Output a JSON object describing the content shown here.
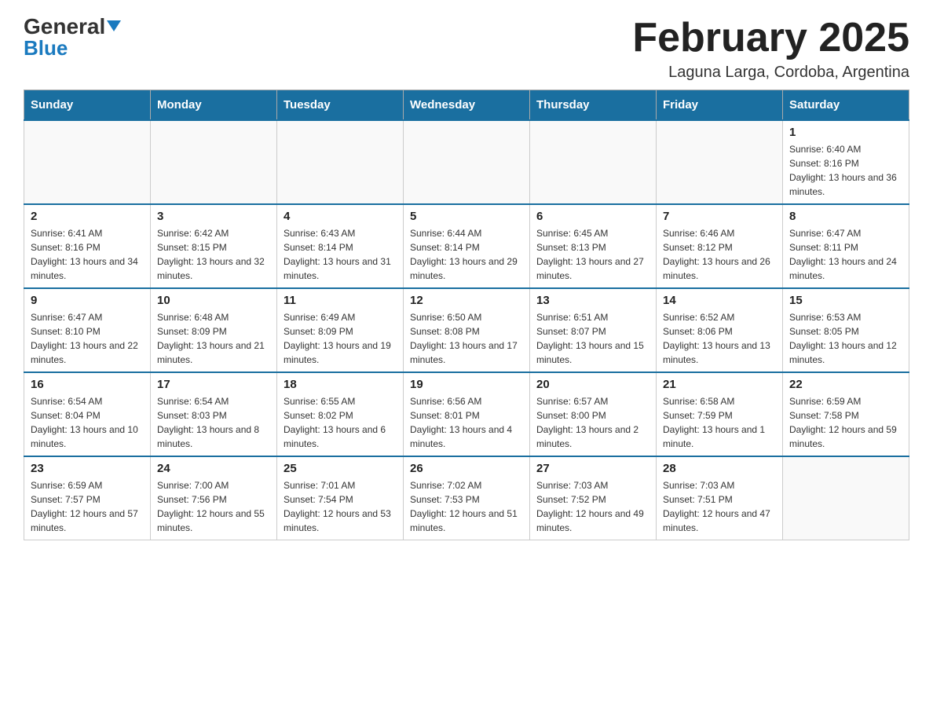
{
  "header": {
    "logo_general": "General",
    "logo_blue": "Blue",
    "title": "February 2025",
    "subtitle": "Laguna Larga, Cordoba, Argentina"
  },
  "days_of_week": [
    "Sunday",
    "Monday",
    "Tuesday",
    "Wednesday",
    "Thursday",
    "Friday",
    "Saturday"
  ],
  "weeks": [
    [
      {
        "day": "",
        "info": ""
      },
      {
        "day": "",
        "info": ""
      },
      {
        "day": "",
        "info": ""
      },
      {
        "day": "",
        "info": ""
      },
      {
        "day": "",
        "info": ""
      },
      {
        "day": "",
        "info": ""
      },
      {
        "day": "1",
        "info": "Sunrise: 6:40 AM\nSunset: 8:16 PM\nDaylight: 13 hours and 36 minutes."
      }
    ],
    [
      {
        "day": "2",
        "info": "Sunrise: 6:41 AM\nSunset: 8:16 PM\nDaylight: 13 hours and 34 minutes."
      },
      {
        "day": "3",
        "info": "Sunrise: 6:42 AM\nSunset: 8:15 PM\nDaylight: 13 hours and 32 minutes."
      },
      {
        "day": "4",
        "info": "Sunrise: 6:43 AM\nSunset: 8:14 PM\nDaylight: 13 hours and 31 minutes."
      },
      {
        "day": "5",
        "info": "Sunrise: 6:44 AM\nSunset: 8:14 PM\nDaylight: 13 hours and 29 minutes."
      },
      {
        "day": "6",
        "info": "Sunrise: 6:45 AM\nSunset: 8:13 PM\nDaylight: 13 hours and 27 minutes."
      },
      {
        "day": "7",
        "info": "Sunrise: 6:46 AM\nSunset: 8:12 PM\nDaylight: 13 hours and 26 minutes."
      },
      {
        "day": "8",
        "info": "Sunrise: 6:47 AM\nSunset: 8:11 PM\nDaylight: 13 hours and 24 minutes."
      }
    ],
    [
      {
        "day": "9",
        "info": "Sunrise: 6:47 AM\nSunset: 8:10 PM\nDaylight: 13 hours and 22 minutes."
      },
      {
        "day": "10",
        "info": "Sunrise: 6:48 AM\nSunset: 8:09 PM\nDaylight: 13 hours and 21 minutes."
      },
      {
        "day": "11",
        "info": "Sunrise: 6:49 AM\nSunset: 8:09 PM\nDaylight: 13 hours and 19 minutes."
      },
      {
        "day": "12",
        "info": "Sunrise: 6:50 AM\nSunset: 8:08 PM\nDaylight: 13 hours and 17 minutes."
      },
      {
        "day": "13",
        "info": "Sunrise: 6:51 AM\nSunset: 8:07 PM\nDaylight: 13 hours and 15 minutes."
      },
      {
        "day": "14",
        "info": "Sunrise: 6:52 AM\nSunset: 8:06 PM\nDaylight: 13 hours and 13 minutes."
      },
      {
        "day": "15",
        "info": "Sunrise: 6:53 AM\nSunset: 8:05 PM\nDaylight: 13 hours and 12 minutes."
      }
    ],
    [
      {
        "day": "16",
        "info": "Sunrise: 6:54 AM\nSunset: 8:04 PM\nDaylight: 13 hours and 10 minutes."
      },
      {
        "day": "17",
        "info": "Sunrise: 6:54 AM\nSunset: 8:03 PM\nDaylight: 13 hours and 8 minutes."
      },
      {
        "day": "18",
        "info": "Sunrise: 6:55 AM\nSunset: 8:02 PM\nDaylight: 13 hours and 6 minutes."
      },
      {
        "day": "19",
        "info": "Sunrise: 6:56 AM\nSunset: 8:01 PM\nDaylight: 13 hours and 4 minutes."
      },
      {
        "day": "20",
        "info": "Sunrise: 6:57 AM\nSunset: 8:00 PM\nDaylight: 13 hours and 2 minutes."
      },
      {
        "day": "21",
        "info": "Sunrise: 6:58 AM\nSunset: 7:59 PM\nDaylight: 13 hours and 1 minute."
      },
      {
        "day": "22",
        "info": "Sunrise: 6:59 AM\nSunset: 7:58 PM\nDaylight: 12 hours and 59 minutes."
      }
    ],
    [
      {
        "day": "23",
        "info": "Sunrise: 6:59 AM\nSunset: 7:57 PM\nDaylight: 12 hours and 57 minutes."
      },
      {
        "day": "24",
        "info": "Sunrise: 7:00 AM\nSunset: 7:56 PM\nDaylight: 12 hours and 55 minutes."
      },
      {
        "day": "25",
        "info": "Sunrise: 7:01 AM\nSunset: 7:54 PM\nDaylight: 12 hours and 53 minutes."
      },
      {
        "day": "26",
        "info": "Sunrise: 7:02 AM\nSunset: 7:53 PM\nDaylight: 12 hours and 51 minutes."
      },
      {
        "day": "27",
        "info": "Sunrise: 7:03 AM\nSunset: 7:52 PM\nDaylight: 12 hours and 49 minutes."
      },
      {
        "day": "28",
        "info": "Sunrise: 7:03 AM\nSunset: 7:51 PM\nDaylight: 12 hours and 47 minutes."
      },
      {
        "day": "",
        "info": ""
      }
    ]
  ]
}
